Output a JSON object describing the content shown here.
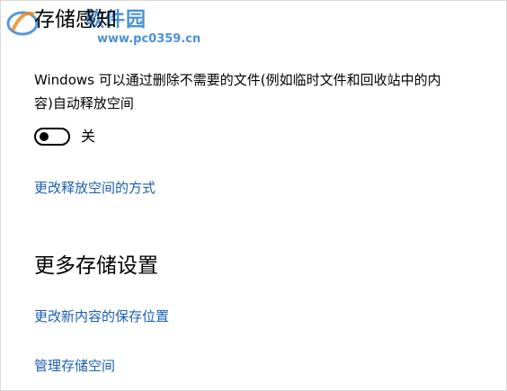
{
  "watermark": {
    "name": "软件园",
    "url": "www.pc0359.cn"
  },
  "storage_sense": {
    "title": "存储感知",
    "description": "Windows 可以通过删除不需要的文件(例如临时文件和回收站中的内容)自动释放空间",
    "toggle": {
      "state_label": "关",
      "on": false
    },
    "change_link": "更改释放空间的方式"
  },
  "more_storage": {
    "title": "更多存储设置",
    "links": [
      "更改新内容的保存位置",
      "管理存储空间"
    ]
  },
  "colors": {
    "link": "#1a5fb4",
    "text": "#000000",
    "watermark": "#2b7fd0"
  }
}
